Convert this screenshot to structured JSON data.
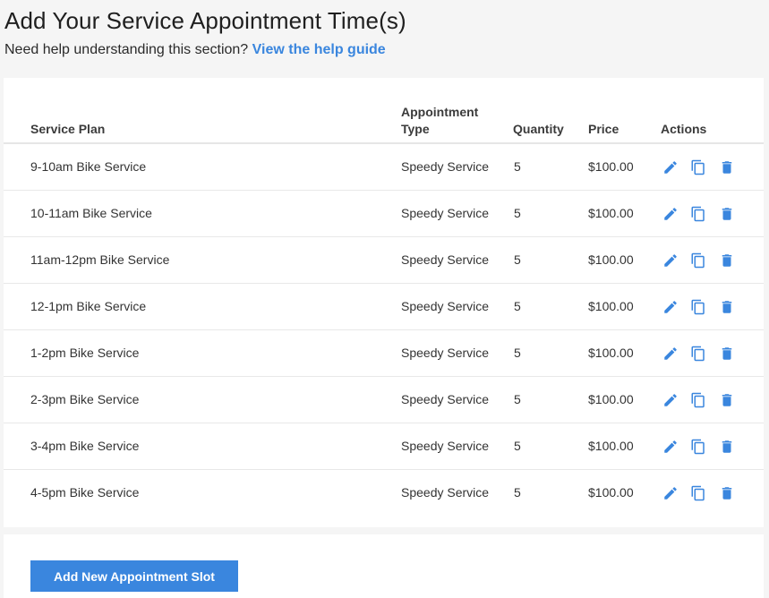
{
  "page": {
    "title": "Add Your Service Appointment Time(s)",
    "help_prompt": "Need help understanding this section?",
    "help_link": "View the help guide"
  },
  "table": {
    "columns": {
      "plan": "Service Plan",
      "type_line1": "Appointment",
      "type_line2": "Type",
      "quantity": "Quantity",
      "price": "Price",
      "actions": "Actions"
    },
    "rows": [
      {
        "plan": "9-10am Bike Service",
        "type": "Speedy Service",
        "quantity": "5",
        "price": "$100.00"
      },
      {
        "plan": "10-11am Bike Service",
        "type": "Speedy Service",
        "quantity": "5",
        "price": "$100.00"
      },
      {
        "plan": "11am-12pm Bike Service",
        "type": "Speedy Service",
        "quantity": "5",
        "price": "$100.00"
      },
      {
        "plan": "12-1pm Bike Service",
        "type": "Speedy Service",
        "quantity": "5",
        "price": "$100.00"
      },
      {
        "plan": "1-2pm Bike Service",
        "type": "Speedy Service",
        "quantity": "5",
        "price": "$100.00"
      },
      {
        "plan": "2-3pm Bike Service",
        "type": "Speedy Service",
        "quantity": "5",
        "price": "$100.00"
      },
      {
        "plan": "3-4pm Bike Service",
        "type": "Speedy Service",
        "quantity": "5",
        "price": "$100.00"
      },
      {
        "plan": "4-5pm Bike Service",
        "type": "Speedy Service",
        "quantity": "5",
        "price": "$100.00"
      }
    ],
    "row_actions": [
      "pencil-icon",
      "copy-icon",
      "trash-icon"
    ]
  },
  "footer": {
    "add_button": "Add New Appointment Slot"
  },
  "colors": {
    "accent": "#3a86de",
    "background": "#f5f5f5",
    "card": "#ffffff"
  }
}
